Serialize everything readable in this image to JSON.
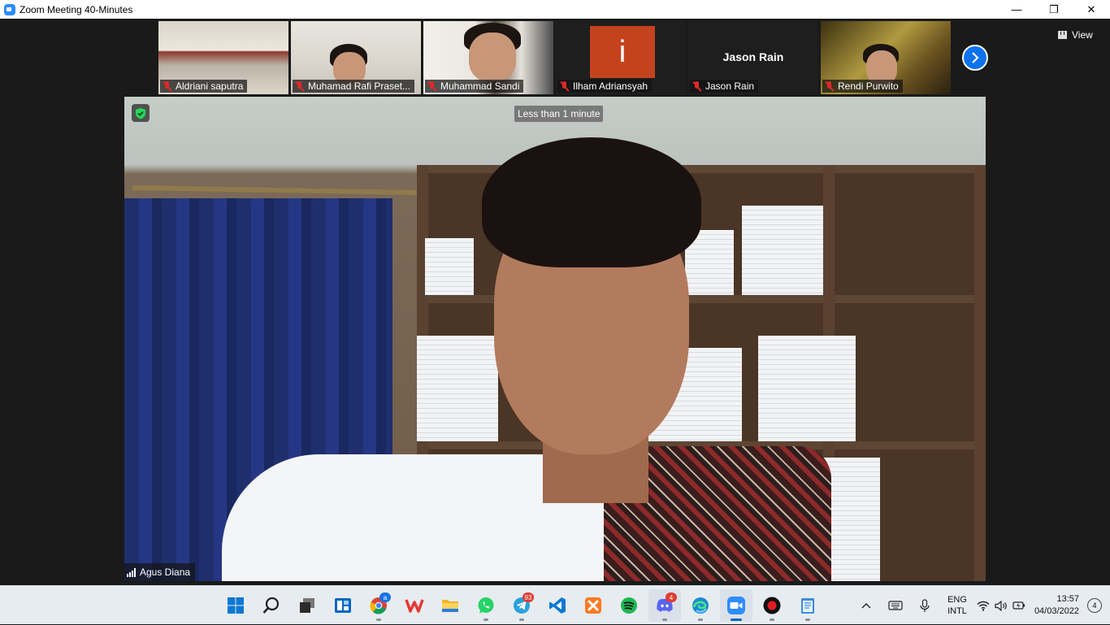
{
  "window": {
    "title": "Zoom Meeting 40-Minutes",
    "minimize": "—",
    "maximize": "❐",
    "close": "✕"
  },
  "gallery": {
    "participants": [
      {
        "name": "Aldriani saputra",
        "muted": true,
        "video": true
      },
      {
        "name": "Muhamad Rafi Praset...",
        "muted": true,
        "video": true
      },
      {
        "name": "Muhammad Sandi",
        "muted": true,
        "video": true
      },
      {
        "name": "Ilham Adriansyah",
        "muted": true,
        "video": false,
        "avatar_letter": "i",
        "avatar_color": "#c4431e"
      },
      {
        "name": "Jason Rain",
        "muted": true,
        "video": false,
        "display_name": "Jason Rain"
      },
      {
        "name": "Rendi Purwito",
        "muted": true,
        "video": true
      }
    ],
    "view_label": "View"
  },
  "main_video": {
    "speaker_name": "Agus Diana",
    "meeting_timer": "Less than 1 minute"
  },
  "taskbar": {
    "apps": [
      {
        "name": "start",
        "color": "#0078d4"
      },
      {
        "name": "search",
        "color": "#222222"
      },
      {
        "name": "task-view",
        "color": "#444444"
      },
      {
        "name": "widgets",
        "color": "#0067c0"
      },
      {
        "name": "chrome",
        "color": "#db4437",
        "badge": "a"
      },
      {
        "name": "wps-office",
        "color": "#e53935"
      },
      {
        "name": "file-explorer",
        "color": "#f5b82e"
      },
      {
        "name": "whatsapp",
        "color": "#25d366"
      },
      {
        "name": "telegram",
        "color": "#2aa1de",
        "badge": "93"
      },
      {
        "name": "vscode",
        "color": "#0a78d4"
      },
      {
        "name": "xampp",
        "color": "#fb7a24"
      },
      {
        "name": "spotify",
        "color": "#1db954"
      },
      {
        "name": "discord",
        "color": "#5865f2",
        "badge": "4"
      },
      {
        "name": "edge",
        "color": "#1a8ad4"
      },
      {
        "name": "zoom",
        "color": "#2d8cff",
        "active": true
      },
      {
        "name": "obs-recorder",
        "color": "#111111"
      },
      {
        "name": "notepad",
        "color": "#3b8ddd"
      }
    ],
    "tray": {
      "language_line1": "ENG",
      "language_line2": "INTL",
      "time": "13:57",
      "date": "04/03/2022",
      "notifications": "4"
    }
  }
}
